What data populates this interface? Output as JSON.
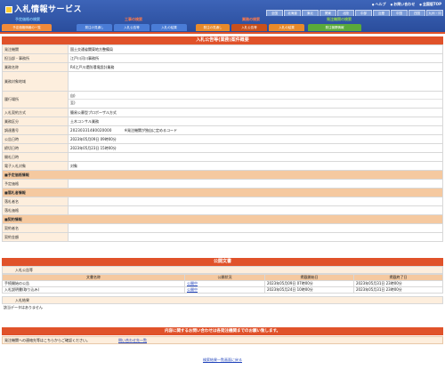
{
  "header": {
    "title": "入札情報サービス",
    "top_links": [
      "ヘルプ",
      "お問い合わせ",
      "全国版TOP"
    ],
    "pref_tabs": [
      "全国",
      "北海道",
      "東北",
      "関東",
      "北陸",
      "中部",
      "近畿",
      "中国",
      "四国",
      "九州・沖"
    ],
    "groups": [
      {
        "title": "予定価格の検索",
        "color": "#7fc0f0",
        "tabs": [
          {
            "label": "予定価格情報の一覧",
            "color": "#f08a3a"
          }
        ]
      },
      {
        "title": "工事の検索",
        "color": "#ff7a4a",
        "tabs": [
          {
            "label": "発注の見通し",
            "color": "#4a7cd6"
          },
          {
            "label": "入札公告等",
            "color": "#4a7cd6"
          },
          {
            "label": "入札の結果",
            "color": "#4a7cd6"
          }
        ]
      },
      {
        "title": "業務の検索",
        "color": "#ff7a4a",
        "tabs": [
          {
            "label": "発注の見通し",
            "color": "#e88a2a"
          },
          {
            "label": "入札公告等",
            "color": "#c8501a"
          },
          {
            "label": "入札の結果",
            "color": "#e88a2a"
          }
        ]
      },
      {
        "title": "発注機関の検索",
        "color": "#8fd04a",
        "tabs": [
          {
            "label": "発注機関情報",
            "color": "#5aaa3a"
          }
        ]
      }
    ]
  },
  "main": {
    "title": "入札公告等(業務)案件概要",
    "rows": [
      {
        "label": "発注機関",
        "value": "国土交通省関東地方整備局"
      },
      {
        "label": "担当部・事務所",
        "value": "江戸川河川事務所"
      },
      {
        "label": "業務名称",
        "value": "R4江戸川堤防環境設計業務"
      },
      {
        "label": "業務対象地域",
        "value": ""
      },
      {
        "label": "履行場所",
        "value_top": "自)",
        "value_bottom": "至)"
      },
      {
        "label": "入札契約方式",
        "value": "簡易公募型プロポーザル方式"
      },
      {
        "label": "業務区分",
        "value": "土木コンサル業務"
      },
      {
        "label": "調達番号",
        "value": "20230331480020000",
        "note": "※発注機関が独自に定めるコード"
      },
      {
        "label": "公告日時",
        "value": "2023年05月09日 09時00分"
      },
      {
        "label": "締切日時",
        "value": "2023年05月23日 15時00分"
      },
      {
        "label": "開札日時",
        "value": ""
      },
      {
        "label": "電子入札対象",
        "value": "対象"
      }
    ],
    "section_estimate": "■予定価格情報",
    "estimate_label": "予定価格",
    "section_winner": "■落札者情報",
    "winner_rows": [
      "落札者名",
      "落札価格"
    ],
    "section_contract": "■契約情報",
    "contract_rows": [
      "契約者名",
      "契約金額"
    ]
  },
  "docs": {
    "title": "公開文書",
    "sub": "入札公告等",
    "columns": [
      "文書名称",
      "公開状況",
      "掲載開始日",
      "掲載終了日"
    ],
    "rows": [
      {
        "name": "手続開始の公告",
        "status": "公開中",
        "start": "2023年05月09日 07時00分",
        "end": "2023年05月31日 23時00分"
      },
      {
        "name": "入札説明書(取り込み)",
        "status": "公開中",
        "start": "2023年05月24日 10時00分",
        "end": "2023年05月31日 23時00分"
      }
    ],
    "result_sub": "入札結果",
    "result_text": "該当データはありません"
  },
  "notice": "内容に関するお問い合わせは各発注機関までのお願い致します。",
  "contact": {
    "text": "発注機関への連絡先等はこちらからご確認ください。",
    "link": "問い合わせ先一覧"
  },
  "back_link": "検索結果一覧画面に戻る"
}
